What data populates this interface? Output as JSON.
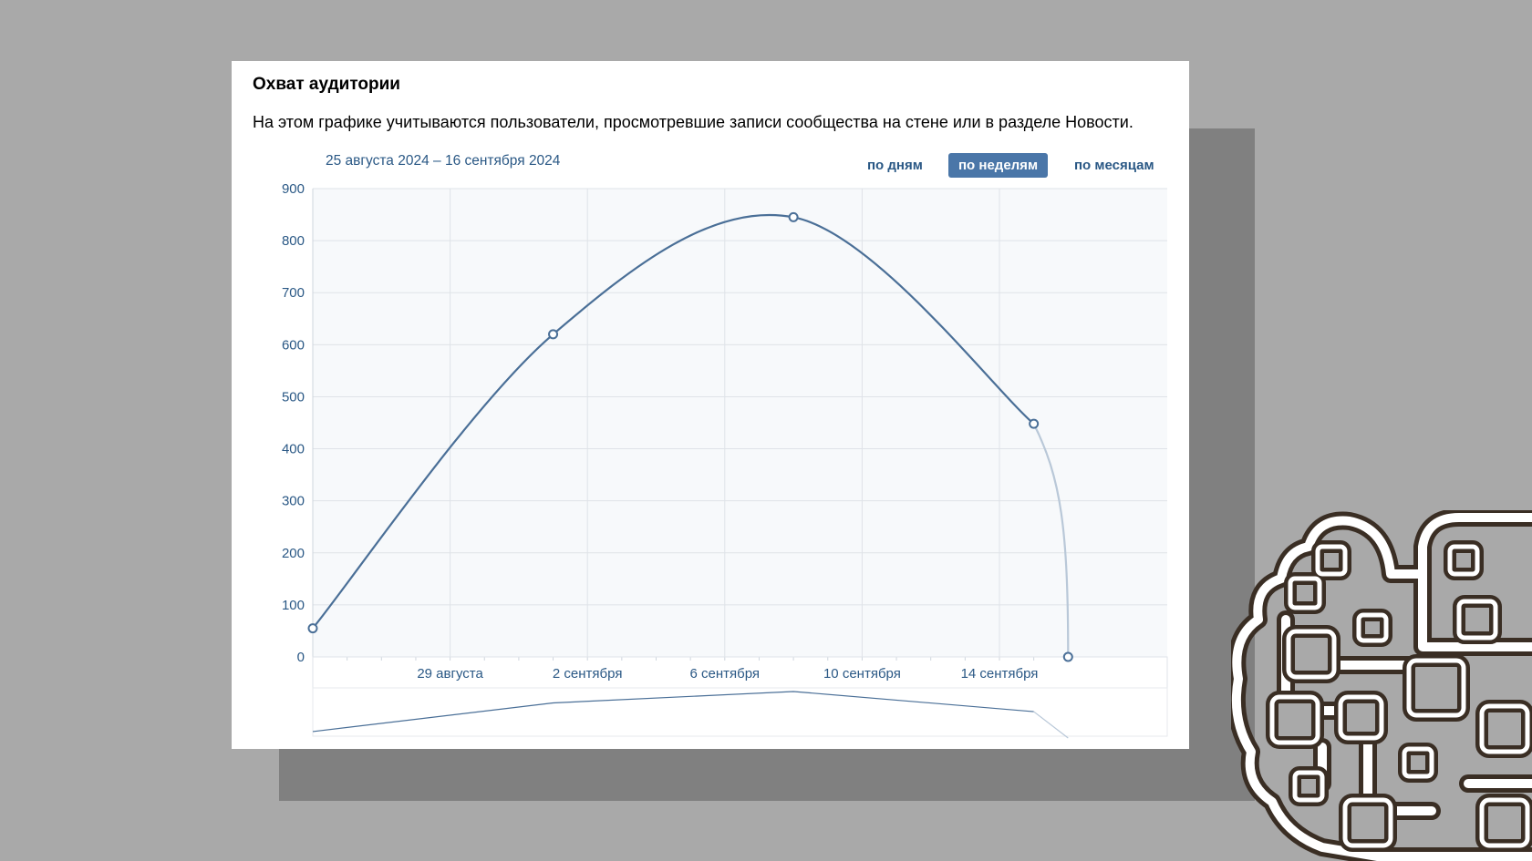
{
  "card": {
    "title": "Охват аудитории",
    "description": "На этом графике учитываются пользователи, просмотревшие записи сообщества на стене или в разделе Новости.",
    "date_range": "25 августа 2024 – 16 сентября 2024"
  },
  "period_switch": {
    "options": [
      "по дням",
      "по неделям",
      "по месяцам"
    ],
    "selected": "по неделям"
  },
  "colors": {
    "line": "#4a6f97",
    "line_partial": "#b9c8d8",
    "plot_bg": "#f7f9fb",
    "grid": "#dfe3e8",
    "accent": "#4a76a8",
    "link": "#2a5885"
  },
  "chart_data": {
    "type": "line",
    "title": "",
    "xlabel": "",
    "ylabel": "",
    "ylim": [
      0,
      900
    ],
    "y_ticks": [
      "900",
      "800",
      "700",
      "600",
      "500",
      "400",
      "300",
      "200",
      "100",
      "0"
    ],
    "x_tick_labels": [
      "29 августа",
      "2 сентября",
      "6 сентября",
      "10 сентября",
      "14 сентября"
    ],
    "x_range": [
      "25 августа 2024",
      "16 сентября 2024"
    ],
    "grid": true,
    "series": [
      {
        "points": [
          {
            "x": "2024-08-25",
            "y": 55
          },
          {
            "x": "2024-09-01",
            "y": 620
          },
          {
            "x": "2024-09-08",
            "y": 845
          },
          {
            "x": "2024-09-15",
            "y": 448
          },
          {
            "x": "2024-09-16",
            "y": 0
          }
        ],
        "last_point_incomplete": true
      }
    ]
  }
}
